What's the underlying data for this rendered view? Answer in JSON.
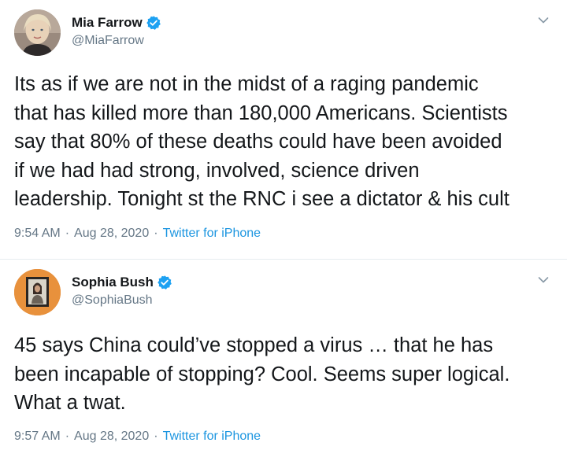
{
  "tweets": [
    {
      "display_name": "Mia Farrow",
      "handle": "@MiaFarrow",
      "verified": true,
      "avatar_icon": "avatar-photo-icon",
      "text": "Its as if we are not in the midst of a raging pandemic\nthat has killed more than 180,000 Americans. Scientists\nsay that 80% of these deaths could have been avoided\nif we had had strong, involved, science driven\nleadership. Tonight st the RNC i see a dictator & his cult",
      "time": "9:54 AM",
      "separator": "·",
      "date": "Aug 28, 2020",
      "source": "Twitter for iPhone"
    },
    {
      "display_name": "Sophia Bush",
      "handle": "@SophiaBush",
      "verified": true,
      "avatar_icon": "avatar-photo-icon",
      "text": "45 says China could’ve stopped a virus … that he has\nbeen incapable of stopping? Cool. Seems super logical.\nWhat a twat.",
      "time": "9:57 AM",
      "separator": "·",
      "date": "Aug 28, 2020",
      "source": "Twitter for iPhone"
    }
  ],
  "colors": {
    "text_primary": "#14171a",
    "text_secondary": "#657786",
    "link": "#1b95e0",
    "verified_badge": "#1da1f2",
    "divider": "#e6ecf0"
  }
}
